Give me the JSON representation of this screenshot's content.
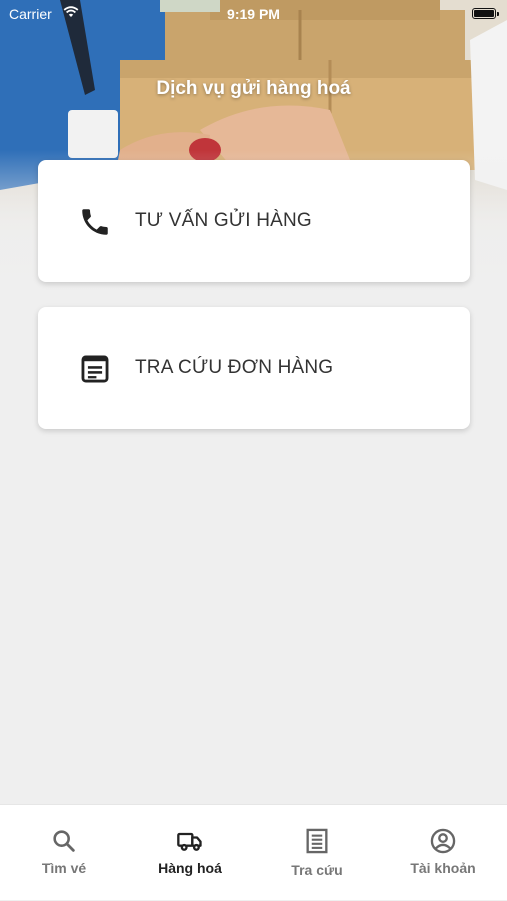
{
  "status_bar": {
    "carrier": "Carrier",
    "time": "9:19 PM"
  },
  "hero": {
    "title": "Dịch vụ gửi hàng hoá"
  },
  "cards": [
    {
      "label": "TƯ VẤN GỬI HÀNG",
      "icon": "phone-icon"
    },
    {
      "label": "TRA CỨU ĐƠN HÀNG",
      "icon": "document-list-icon"
    }
  ],
  "tab_bar": {
    "items": [
      {
        "label": "Tìm vé",
        "icon": "search-icon",
        "active": false
      },
      {
        "label": "Hàng hoá",
        "icon": "truck-icon",
        "active": true
      },
      {
        "label": "Tra cứu",
        "icon": "receipt-icon",
        "active": false
      },
      {
        "label": "Tài khoản",
        "icon": "account-circle-icon",
        "active": false
      }
    ]
  },
  "colors": {
    "background": "#efefef",
    "card": "#ffffff",
    "text_primary": "#333333",
    "tab_active": "#222222",
    "tab_inactive": "#777777"
  }
}
